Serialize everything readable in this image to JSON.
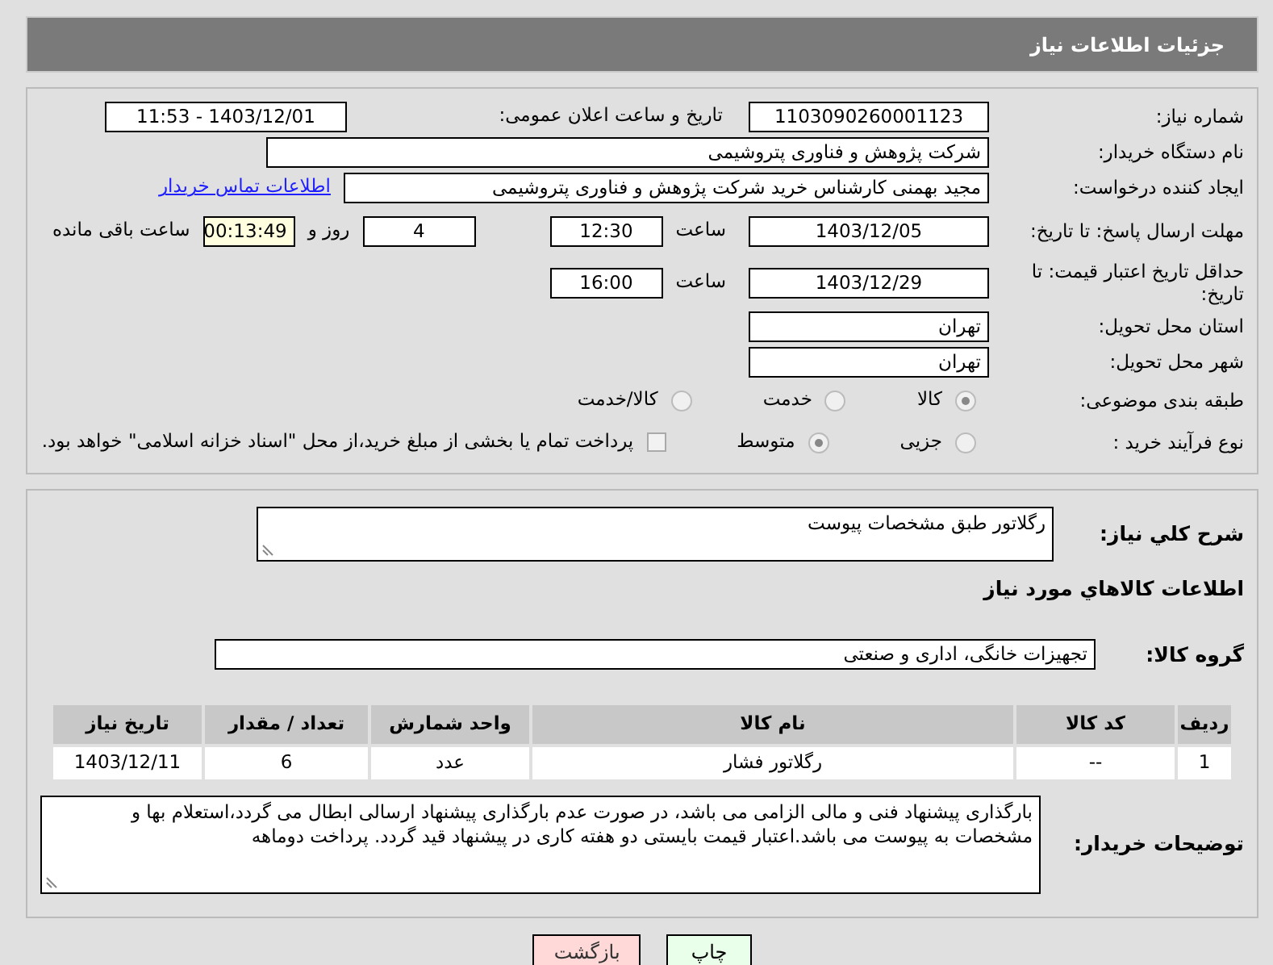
{
  "header": {
    "title": "جزئیات اطلاعات نیاز"
  },
  "need_number": {
    "label": "شماره نیاز:",
    "value": "1103090260001123"
  },
  "announce": {
    "label": "تاریخ و ساعت اعلان عمومی:",
    "value": "1403/12/01 - 11:53"
  },
  "buyer_org": {
    "label": "نام دستگاه خریدار:",
    "value": "شرکت پژوهش و فناوری پتروشیمی"
  },
  "requester": {
    "label": "ایجاد کننده درخواست:",
    "value": "مجید بهمنی کارشناس خرید شرکت پژوهش و فناوری پتروشیمی",
    "link": "اطلاعات تماس خریدار"
  },
  "reply_deadline": {
    "label": "مهلت ارسال پاسخ: تا تاریخ:",
    "date": "1403/12/05",
    "time_label": "ساعت",
    "time": "12:30",
    "days": "4",
    "days_label": "روز و",
    "remaining": "00:13:49",
    "remaining_label": "ساعت باقی مانده"
  },
  "price_validity": {
    "label": "حداقل تاریخ اعتبار قیمت: تا تاریخ:",
    "date": "1403/12/29",
    "time_label": "ساعت",
    "time": "16:00"
  },
  "province": {
    "label": "استان محل تحویل:",
    "value": "تهران"
  },
  "city": {
    "label": "شهر محل تحویل:",
    "value": "تهران"
  },
  "category": {
    "label": "طبقه بندی موضوعی:",
    "options": [
      {
        "label": "کالا",
        "selected": true
      },
      {
        "label": "خدمت",
        "selected": false
      },
      {
        "label": "کالا/خدمت",
        "selected": false
      }
    ]
  },
  "process": {
    "label": "نوع فرآیند خرید :",
    "options": [
      {
        "label": "جزیی",
        "selected": false
      },
      {
        "label": "متوسط",
        "selected": true
      }
    ],
    "payment": {
      "label": "پرداخت تمام یا بخشی از مبلغ خرید،از محل \"اسناد خزانه اسلامی\" خواهد بود.",
      "checked": false
    }
  },
  "description": {
    "label": "شرح کلي نياز:",
    "value": "رگلاتور طبق مشخصات پیوست"
  },
  "goods_title": "اطلاعات کالاهاي مورد نياز",
  "goods_group": {
    "label": "گروه کالا:",
    "value": "تجهیزات خانگی، اداری و صنعتی"
  },
  "table": {
    "columns": [
      "رديف",
      "کد کالا",
      "نام کالا",
      "واحد شمارش",
      "تعداد / مقدار",
      "تاريخ نياز"
    ],
    "rows": [
      [
        "1",
        "--",
        "رگلاتور فشار",
        "عدد",
        "6",
        "1403/12/11"
      ]
    ]
  },
  "notes": {
    "label": "توضیحات خریدار:",
    "value": "بارگذاری پیشنهاد فنی و مالی الزامی می باشد، در صورت عدم بارگذاری پیشنهاد ارسالی ابطال می گردد،استعلام بها و مشخصات به پیوست می باشد.اعتبار قیمت بایستی دو هفته کاری در پیشنهاد قید گردد. پرداخت دوماهه"
  },
  "buttons": [
    {
      "label": "چاپ",
      "kind": "print"
    },
    {
      "label": "بازگشت",
      "kind": "back"
    }
  ]
}
